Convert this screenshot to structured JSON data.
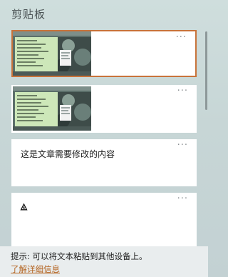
{
  "panel": {
    "title": "剪贴板"
  },
  "items": [
    {
      "type": "image",
      "more": "···",
      "selected": true
    },
    {
      "type": "image",
      "more": "···",
      "selected": false
    },
    {
      "type": "text",
      "more": "···",
      "text": "这是文章需要修改的内容"
    },
    {
      "type": "symbol",
      "more": "···",
      "icon": "warning-icon"
    }
  ],
  "footer": {
    "tip": "提示: 可以将文本粘贴到其他设备上。",
    "link": "了解详细信息"
  },
  "colors": {
    "selection_border": "#c8733a",
    "link": "#b3621e",
    "background": "#c9d8d8"
  }
}
